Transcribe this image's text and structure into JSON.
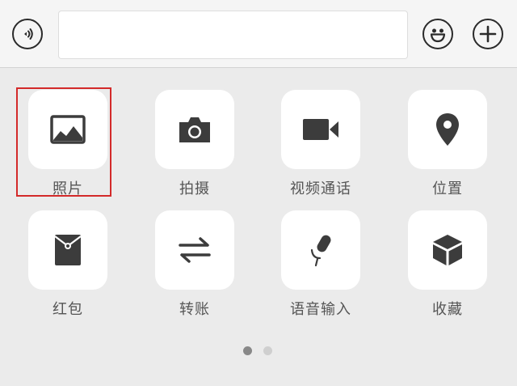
{
  "input_bar": {
    "voice_icon": "voice-wave-icon",
    "text_value": "",
    "emoji_icon": "smiley-face-icon",
    "plus_icon": "plus-icon"
  },
  "panel": {
    "items": [
      {
        "label": "照片",
        "icon": "image-icon"
      },
      {
        "label": "拍摄",
        "icon": "camera-icon"
      },
      {
        "label": "视频通话",
        "icon": "video-camera-icon"
      },
      {
        "label": "位置",
        "icon": "location-pin-icon"
      },
      {
        "label": "红包",
        "icon": "red-envelope-icon"
      },
      {
        "label": "转账",
        "icon": "transfer-arrows-icon"
      },
      {
        "label": "语音输入",
        "icon": "microphone-icon"
      },
      {
        "label": "收藏",
        "icon": "cube-icon"
      }
    ],
    "highlighted_index": 0
  },
  "pager": {
    "page_count": 2,
    "current_page": 1
  },
  "colors": {
    "background": "#ebebeb",
    "icon": "#3c3c3c",
    "highlight": "#d32a2a"
  }
}
